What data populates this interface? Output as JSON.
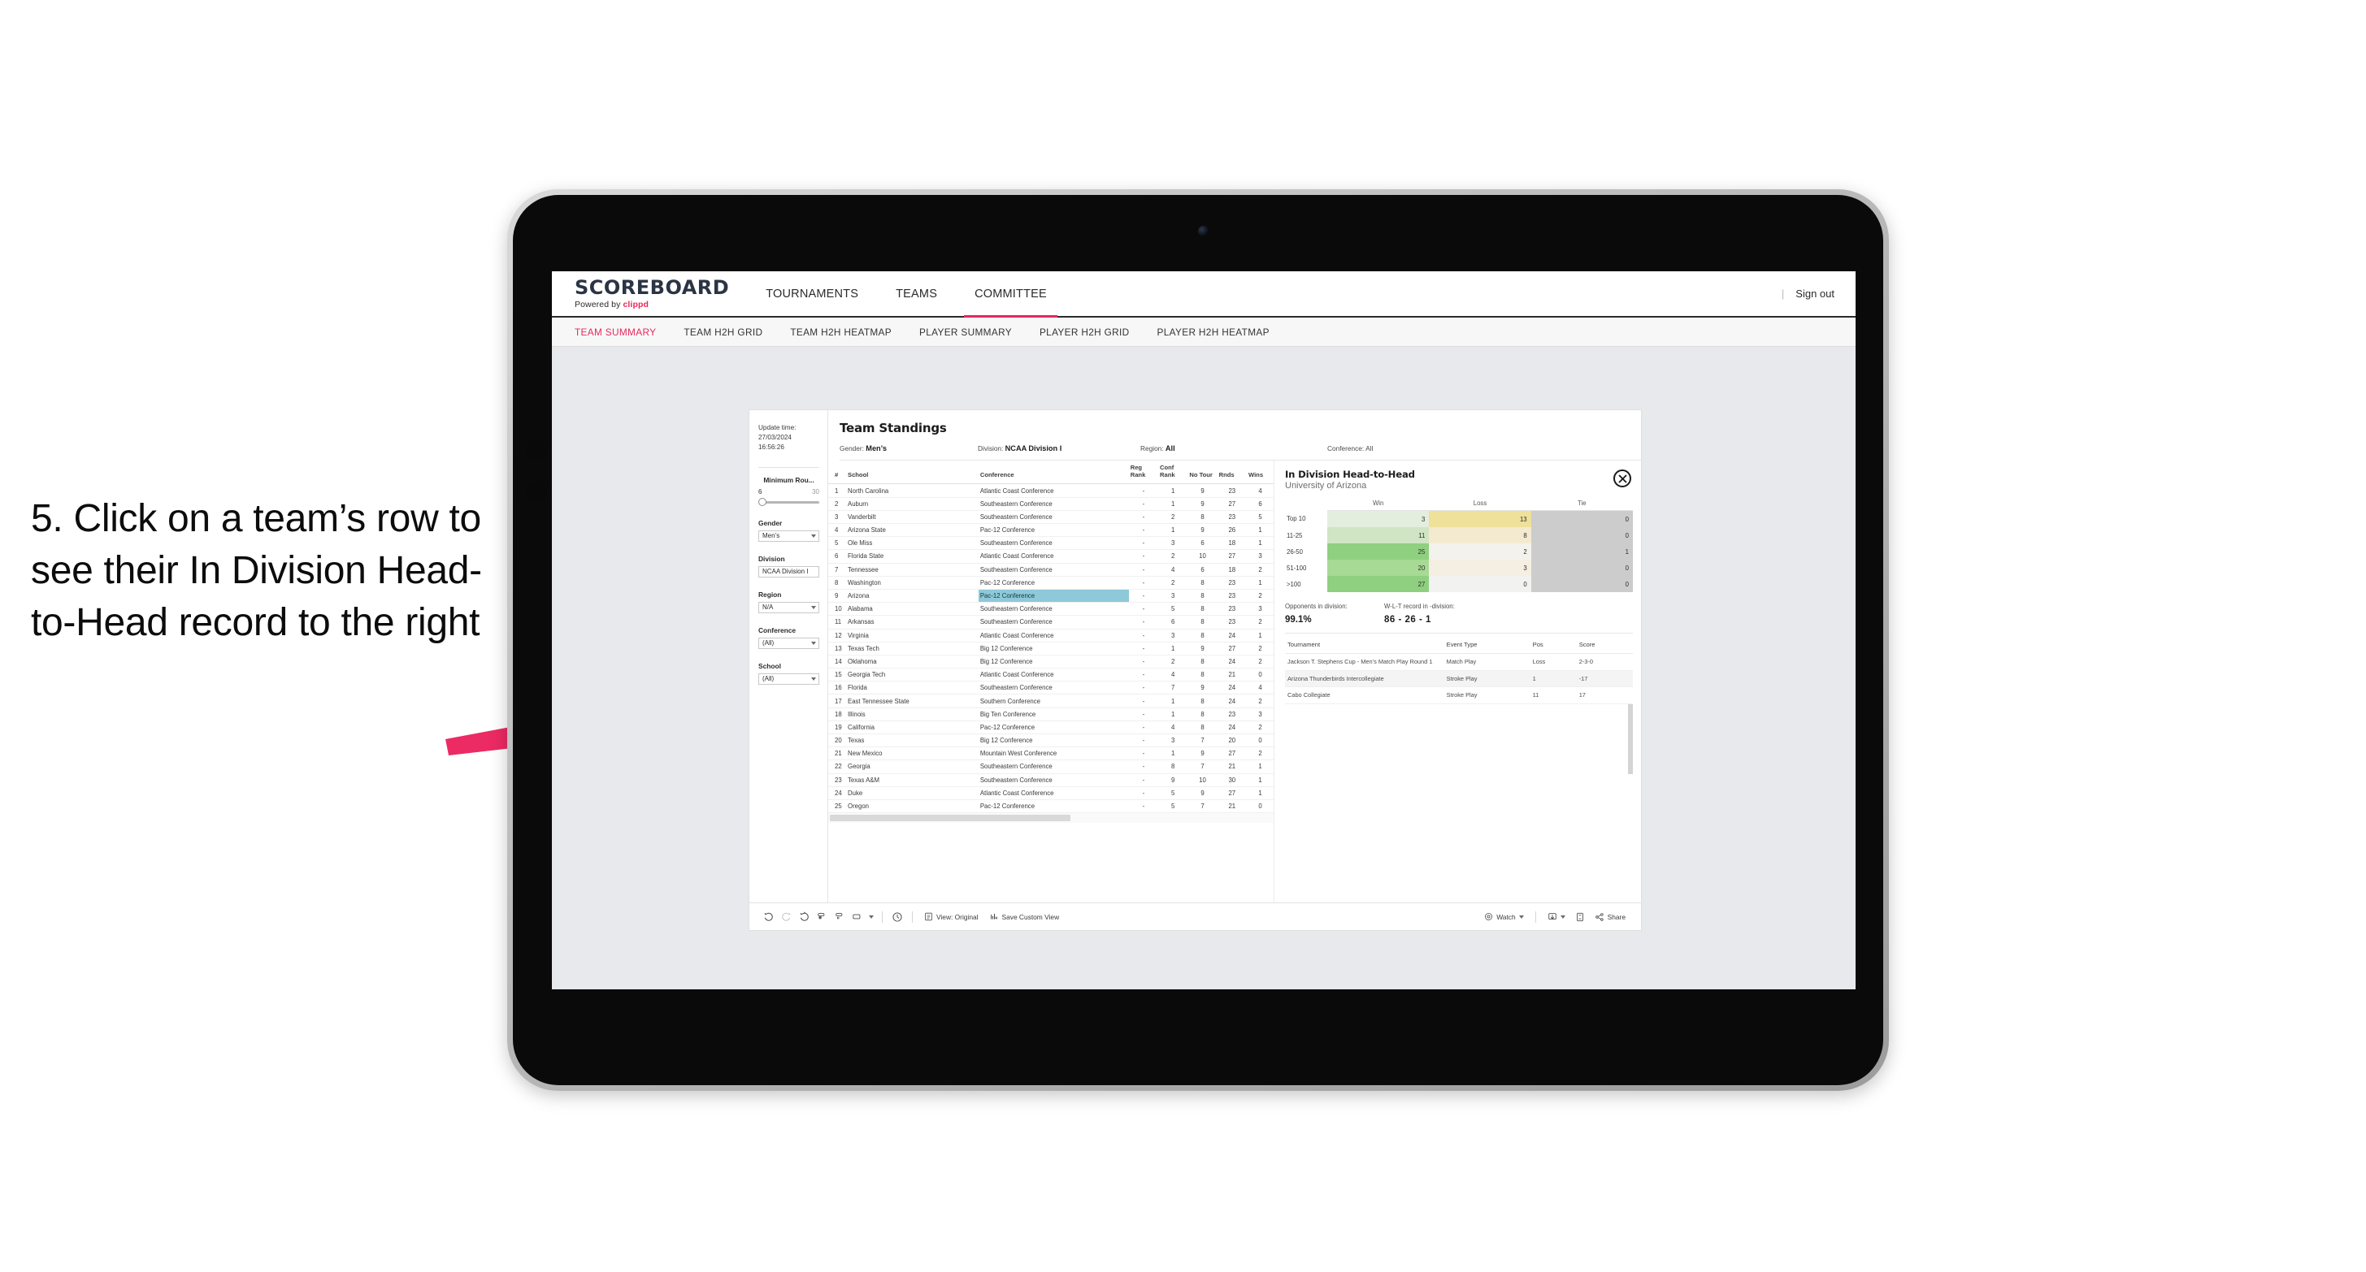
{
  "annotation": {
    "text": "5. Click on a team’s row to see their In Division Head-to-Head record to the right",
    "arrow_color": "#ec2a64"
  },
  "header": {
    "brand_title": "SCOREBOARD",
    "brand_sub_prefix": "Powered by ",
    "brand_sub_name": "clippd",
    "nav": [
      {
        "label": "TOURNAMENTS",
        "active": false
      },
      {
        "label": "TEAMS",
        "active": false
      },
      {
        "label": "COMMITTEE",
        "active": true
      }
    ],
    "divider": "|",
    "signout": "Sign out",
    "accent": "#e8275a"
  },
  "subnav": [
    {
      "label": "TEAM SUMMARY",
      "active": true
    },
    {
      "label": "TEAM H2H GRID",
      "active": false
    },
    {
      "label": "TEAM H2H HEATMAP",
      "active": false
    },
    {
      "label": "PLAYER SUMMARY",
      "active": false
    },
    {
      "label": "PLAYER H2H GRID",
      "active": false
    },
    {
      "label": "PLAYER H2H HEATMAP",
      "active": false
    }
  ],
  "filters": {
    "update_time_label": "Update time:",
    "update_time_value": "27/03/2024 16:56:26",
    "slider": {
      "label": "Minimum Rou...",
      "min": "6",
      "max": "30"
    },
    "groups": [
      {
        "label": "Gender",
        "value": "Men’s"
      },
      {
        "label": "Division",
        "value": "NCAA Division I"
      },
      {
        "label": "Region",
        "value": "N/A"
      },
      {
        "label": "Conference",
        "value": "(All)"
      },
      {
        "label": "School",
        "value": "(All)"
      }
    ]
  },
  "standings": {
    "title": "Team Standings",
    "summary": [
      {
        "label": "Gender:",
        "value": "Men’s"
      },
      {
        "label": "Division:",
        "value": "NCAA Division I"
      },
      {
        "label": "Region:",
        "value": "All"
      },
      {
        "label": "Conference:",
        "value": "All"
      }
    ],
    "columns": [
      "#",
      "School",
      "Conference",
      "Reg Rank",
      "Conf Rank",
      "No Tour",
      "Rnds",
      "Wins"
    ],
    "selected_row": 9,
    "rows": [
      {
        "rank": "1",
        "school": "North Carolina",
        "conference": "Atlantic Coast Conference",
        "reg_rank": "-",
        "conf_rank": "1",
        "no_tour": "9",
        "rnds": "23",
        "wins": "4"
      },
      {
        "rank": "2",
        "school": "Auburn",
        "conference": "Southeastern Conference",
        "reg_rank": "-",
        "conf_rank": "1",
        "no_tour": "9",
        "rnds": "27",
        "wins": "6"
      },
      {
        "rank": "3",
        "school": "Vanderbilt",
        "conference": "Southeastern Conference",
        "reg_rank": "-",
        "conf_rank": "2",
        "no_tour": "8",
        "rnds": "23",
        "wins": "5"
      },
      {
        "rank": "4",
        "school": "Arizona State",
        "conference": "Pac-12 Conference",
        "reg_rank": "-",
        "conf_rank": "1",
        "no_tour": "9",
        "rnds": "26",
        "wins": "1"
      },
      {
        "rank": "5",
        "school": "Ole Miss",
        "conference": "Southeastern Conference",
        "reg_rank": "-",
        "conf_rank": "3",
        "no_tour": "6",
        "rnds": "18",
        "wins": "1"
      },
      {
        "rank": "6",
        "school": "Florida State",
        "conference": "Atlantic Coast Conference",
        "reg_rank": "-",
        "conf_rank": "2",
        "no_tour": "10",
        "rnds": "27",
        "wins": "3"
      },
      {
        "rank": "7",
        "school": "Tennessee",
        "conference": "Southeastern Conference",
        "reg_rank": "-",
        "conf_rank": "4",
        "no_tour": "6",
        "rnds": "18",
        "wins": "2"
      },
      {
        "rank": "8",
        "school": "Washington",
        "conference": "Pac-12 Conference",
        "reg_rank": "-",
        "conf_rank": "2",
        "no_tour": "8",
        "rnds": "23",
        "wins": "1"
      },
      {
        "rank": "9",
        "school": "Arizona",
        "conference": "Pac-12 Conference",
        "reg_rank": "-",
        "conf_rank": "3",
        "no_tour": "8",
        "rnds": "23",
        "wins": "2"
      },
      {
        "rank": "10",
        "school": "Alabama",
        "conference": "Southeastern Conference",
        "reg_rank": "-",
        "conf_rank": "5",
        "no_tour": "8",
        "rnds": "23",
        "wins": "3"
      },
      {
        "rank": "11",
        "school": "Arkansas",
        "conference": "Southeastern Conference",
        "reg_rank": "-",
        "conf_rank": "6",
        "no_tour": "8",
        "rnds": "23",
        "wins": "2"
      },
      {
        "rank": "12",
        "school": "Virginia",
        "conference": "Atlantic Coast Conference",
        "reg_rank": "-",
        "conf_rank": "3",
        "no_tour": "8",
        "rnds": "24",
        "wins": "1"
      },
      {
        "rank": "13",
        "school": "Texas Tech",
        "conference": "Big 12 Conference",
        "reg_rank": "-",
        "conf_rank": "1",
        "no_tour": "9",
        "rnds": "27",
        "wins": "2"
      },
      {
        "rank": "14",
        "school": "Oklahoma",
        "conference": "Big 12 Conference",
        "reg_rank": "-",
        "conf_rank": "2",
        "no_tour": "8",
        "rnds": "24",
        "wins": "2"
      },
      {
        "rank": "15",
        "school": "Georgia Tech",
        "conference": "Atlantic Coast Conference",
        "reg_rank": "-",
        "conf_rank": "4",
        "no_tour": "8",
        "rnds": "21",
        "wins": "0"
      },
      {
        "rank": "16",
        "school": "Florida",
        "conference": "Southeastern Conference",
        "reg_rank": "-",
        "conf_rank": "7",
        "no_tour": "9",
        "rnds": "24",
        "wins": "4"
      },
      {
        "rank": "17",
        "school": "East Tennessee State",
        "conference": "Southern Conference",
        "reg_rank": "-",
        "conf_rank": "1",
        "no_tour": "8",
        "rnds": "24",
        "wins": "2"
      },
      {
        "rank": "18",
        "school": "Illinois",
        "conference": "Big Ten Conference",
        "reg_rank": "-",
        "conf_rank": "1",
        "no_tour": "8",
        "rnds": "23",
        "wins": "3"
      },
      {
        "rank": "19",
        "school": "California",
        "conference": "Pac-12 Conference",
        "reg_rank": "-",
        "conf_rank": "4",
        "no_tour": "8",
        "rnds": "24",
        "wins": "2"
      },
      {
        "rank": "20",
        "school": "Texas",
        "conference": "Big 12 Conference",
        "reg_rank": "-",
        "conf_rank": "3",
        "no_tour": "7",
        "rnds": "20",
        "wins": "0"
      },
      {
        "rank": "21",
        "school": "New Mexico",
        "conference": "Mountain West Conference",
        "reg_rank": "-",
        "conf_rank": "1",
        "no_tour": "9",
        "rnds": "27",
        "wins": "2"
      },
      {
        "rank": "22",
        "school": "Georgia",
        "conference": "Southeastern Conference",
        "reg_rank": "-",
        "conf_rank": "8",
        "no_tour": "7",
        "rnds": "21",
        "wins": "1"
      },
      {
        "rank": "23",
        "school": "Texas A&M",
        "conference": "Southeastern Conference",
        "reg_rank": "-",
        "conf_rank": "9",
        "no_tour": "10",
        "rnds": "30",
        "wins": "1"
      },
      {
        "rank": "24",
        "school": "Duke",
        "conference": "Atlantic Coast Conference",
        "reg_rank": "-",
        "conf_rank": "5",
        "no_tour": "9",
        "rnds": "27",
        "wins": "1"
      },
      {
        "rank": "25",
        "school": "Oregon",
        "conference": "Pac-12 Conference",
        "reg_rank": "-",
        "conf_rank": "5",
        "no_tour": "7",
        "rnds": "21",
        "wins": "0"
      }
    ]
  },
  "h2h": {
    "title": "In Division Head-to-Head",
    "subtitle": "University of Arizona",
    "close_icon": "close-circle-icon",
    "columns": [
      "Win",
      "Loss",
      "Tie"
    ],
    "rows": [
      {
        "label": "Top 10",
        "win": "3",
        "loss": "13",
        "tie": "0",
        "win_color": "#e3eede",
        "loss_color": "#efe09a",
        "tie_color": "#cccccc"
      },
      {
        "label": "11-25",
        "win": "11",
        "loss": "8",
        "tie": "0",
        "win_color": "#cfe5c4",
        "loss_color": "#f4ead0",
        "tie_color": "#cccccc"
      },
      {
        "label": "26-50",
        "win": "25",
        "loss": "2",
        "tie": "1",
        "win_color": "#8ed07f",
        "loss_color": "#f3f2ec",
        "tie_color": "#cccccc"
      },
      {
        "label": "51-100",
        "win": "20",
        "loss": "3",
        "tie": "0",
        "win_color": "#a7da94",
        "loss_color": "#f4efe2",
        "tie_color": "#cccccc"
      },
      {
        "label": ">100",
        "win": "27",
        "loss": "0",
        "tie": "0",
        "win_color": "#8ed07f",
        "loss_color": "#f2f2f0",
        "tie_color": "#cccccc"
      }
    ],
    "summary": {
      "opponents_label": "Opponents in division:",
      "opponents_value": "99.1%",
      "record_label": "W-L-T record in -division:",
      "record_value": "86 - 26 - 1"
    },
    "tournament_columns": [
      "Tournament",
      "Event Type",
      "Pos",
      "Score"
    ],
    "tournaments": [
      {
        "name": "Jackson T. Stephens Cup - Men’s Match Play Round 1",
        "type": "Match Play",
        "pos": "Loss",
        "score": "2-3-0"
      },
      {
        "name": "Arizona Thunderbirds Intercollegiate",
        "type": "Stroke Play",
        "pos": "1",
        "score": "-17"
      },
      {
        "name": "Cabo Collegiate",
        "type": "Stroke Play",
        "pos": "11",
        "score": "17"
      }
    ]
  },
  "toolbar": {
    "icons": [
      "undo-icon",
      "redo-icon",
      "revert-icon",
      "refresh-data-icon",
      "pause-updates-icon",
      "device-layout-icon"
    ],
    "view_label": "View: Original",
    "save_label": "Save Custom View",
    "watch_label": "Watch",
    "share_label": "Share",
    "alert_icon": "alert-icon",
    "download_icon": "download-icon",
    "fullscreen_icon": "fullscreen-icon"
  }
}
